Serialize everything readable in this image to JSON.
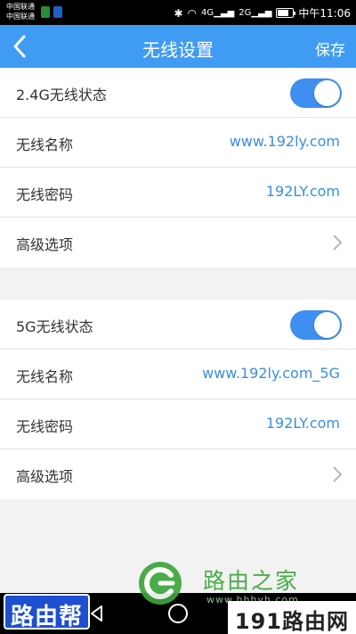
{
  "status_bar": {
    "carrier_1": "中国联通",
    "carrier_2": "中国联通",
    "network_1": "4G",
    "network_2": "2G",
    "time": "中午11:06"
  },
  "header": {
    "title": "无线设置",
    "save_label": "保存"
  },
  "band_24g": {
    "status_label": "2.4G无线状态",
    "status_on": true,
    "name_label": "无线名称",
    "name_value": "www.192ly.com",
    "password_label": "无线密码",
    "password_value": "192LY.com",
    "advanced_label": "高级选项"
  },
  "band_5g": {
    "status_label": "5G无线状态",
    "status_on": true,
    "name_label": "无线名称",
    "name_value": "www.192ly.com_5G",
    "password_label": "无线密码",
    "password_value": "192LY.com",
    "advanced_label": "高级选项"
  },
  "watermarks": {
    "left": "路由帮",
    "center_brand": "路由之家",
    "center_url": "www.hhhyh.com",
    "right": "191路由网"
  },
  "colors": {
    "accent": "#3f9cf2",
    "link_text": "#3a8ee6",
    "toggle_on": "#3f8ff0"
  }
}
